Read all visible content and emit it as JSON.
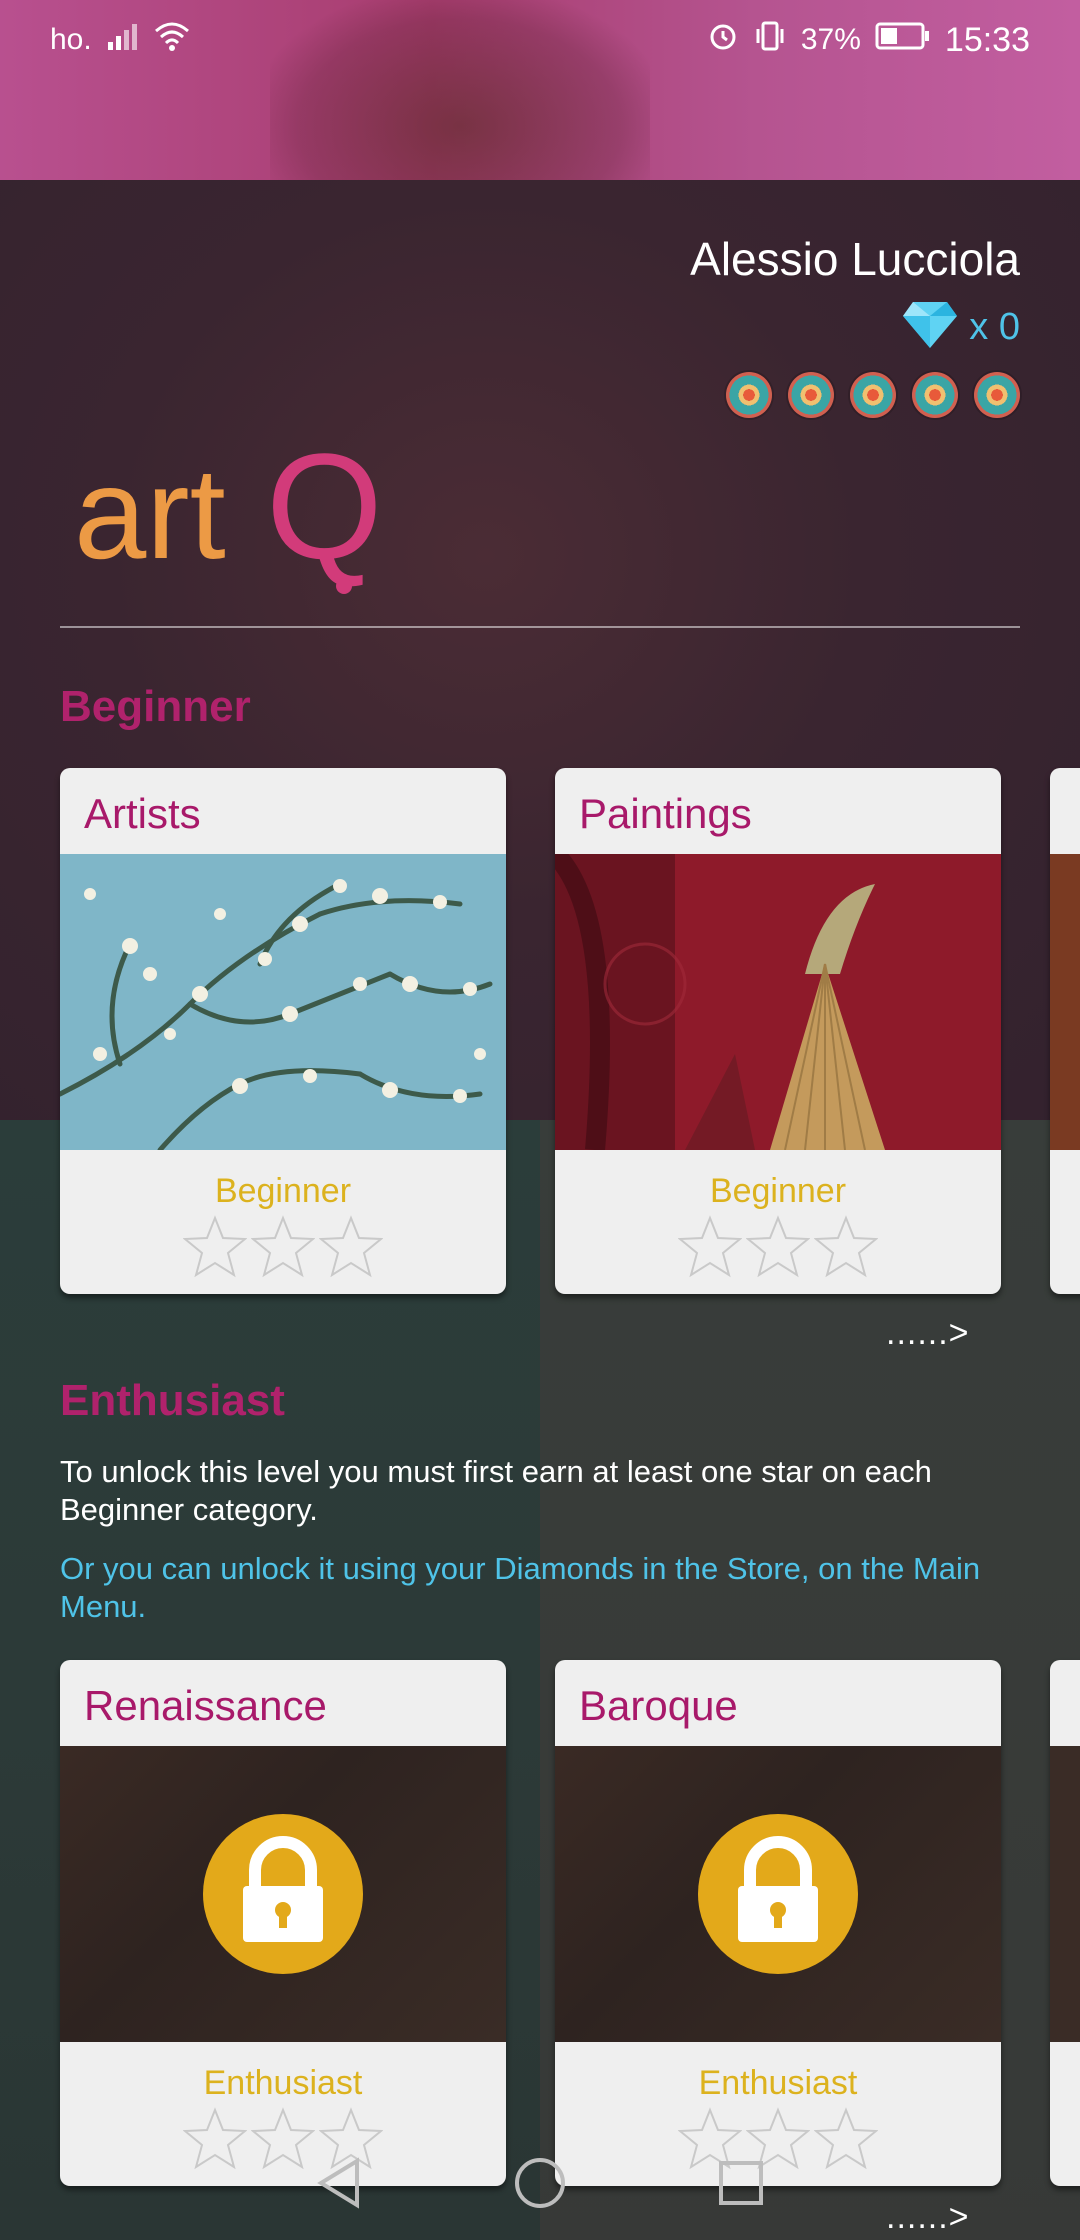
{
  "status_bar": {
    "carrier": "ho.",
    "battery": "37%",
    "time": "15:33"
  },
  "header": {
    "user_name": "Alessio Lucciola",
    "diamond_count": "x 0",
    "badge_count": 5,
    "logo_text_art": "art",
    "logo_text_q": "Q"
  },
  "sections": {
    "beginner": {
      "title": "Beginner",
      "cards": [
        {
          "title": "Artists",
          "level": "Beginner",
          "stars": 0
        },
        {
          "title": "Paintings",
          "level": "Beginner",
          "stars": 0
        }
      ],
      "more": "......>"
    },
    "enthusiast": {
      "title": "Enthusiast",
      "unlock_text": "To unlock this level you must first earn at least one star on each Beginner category.",
      "store_text": "Or you can unlock it using your Diamonds in the Store, on the Main Menu.",
      "cards": [
        {
          "title": "Renaissance",
          "level": "Enthusiast",
          "stars": 0,
          "locked": true
        },
        {
          "title": "Baroque",
          "level": "Enthusiast",
          "stars": 0,
          "locked": true
        }
      ],
      "more": "......>"
    }
  },
  "colors": {
    "accent": "#b0226c",
    "level_gold": "#dcb21e",
    "diamond_blue": "#4fc3e8",
    "lock_gold": "#e3a91a"
  },
  "icons": [
    "signal-icon",
    "wifi-icon",
    "alarm-icon",
    "vibrate-icon",
    "battery-icon",
    "diamond-icon",
    "lock-icon",
    "star-icon",
    "back-icon",
    "home-icon",
    "recents-icon"
  ]
}
